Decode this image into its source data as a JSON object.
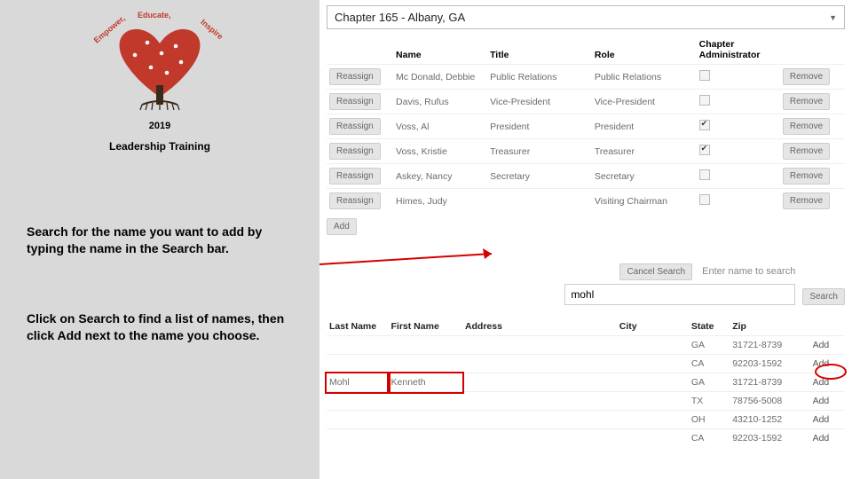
{
  "sidebar": {
    "arc_words": [
      "Empower,",
      "Educate,",
      "Inspire"
    ],
    "year": "2019",
    "subtitle": "Leadership Training",
    "inst1": "Search for the name you want to add by typing the name in the Search bar.",
    "inst2": "Click on Search to find a list of names, then click Add next to the name you choose."
  },
  "main": {
    "dropdown": "Chapter 165 - Albany, GA",
    "headers": {
      "name": "Name",
      "title": "Title",
      "role": "Role",
      "admin_l1": "Chapter",
      "admin_l2": "Administrator"
    },
    "reassign_label": "Reassign",
    "remove_label": "Remove",
    "add_label": "Add",
    "rows": [
      {
        "name": "Mc Donald, Debbie",
        "title": "Public Relations",
        "role": "Public Relations",
        "admin": false
      },
      {
        "name": "Davis, Rufus",
        "title": "Vice-President",
        "role": "Vice-President",
        "admin": false
      },
      {
        "name": "Voss, Al",
        "title": "President",
        "role": "President",
        "admin": true
      },
      {
        "name": "Voss, Kristie",
        "title": "Treasurer",
        "role": "Treasurer",
        "admin": true
      },
      {
        "name": "Askey, Nancy",
        "title": "Secretary",
        "role": "Secretary",
        "admin": false
      },
      {
        "name": "Himes, Judy",
        "title": "",
        "role": "Visiting Chairman",
        "admin": false
      }
    ],
    "search": {
      "cancel": "Cancel Search",
      "placeholder": "Enter name to search",
      "value": "mohl",
      "go": "Search"
    },
    "results": {
      "headers": {
        "last": "Last Name",
        "first": "First Name",
        "address": "Address",
        "city": "City",
        "state": "State",
        "zip": "Zip"
      },
      "rows": [
        {
          "last": "",
          "first": "",
          "state": "GA",
          "zip": "31721-8739",
          "add": "Add"
        },
        {
          "last": "",
          "first": "",
          "state": "CA",
          "zip": "92203-1592",
          "add": "Add"
        },
        {
          "last": "Mohl",
          "first": "Kenneth",
          "state": "GA",
          "zip": "31721-8739",
          "add": "Add",
          "hl": true
        },
        {
          "last": "",
          "first": "",
          "state": "TX",
          "zip": "78756-5008",
          "add": "Add"
        },
        {
          "last": "",
          "first": "",
          "state": "OH",
          "zip": "43210-1252",
          "add": "Add"
        },
        {
          "last": "",
          "first": "",
          "state": "CA",
          "zip": "92203-1592",
          "add": "Add"
        }
      ]
    }
  }
}
